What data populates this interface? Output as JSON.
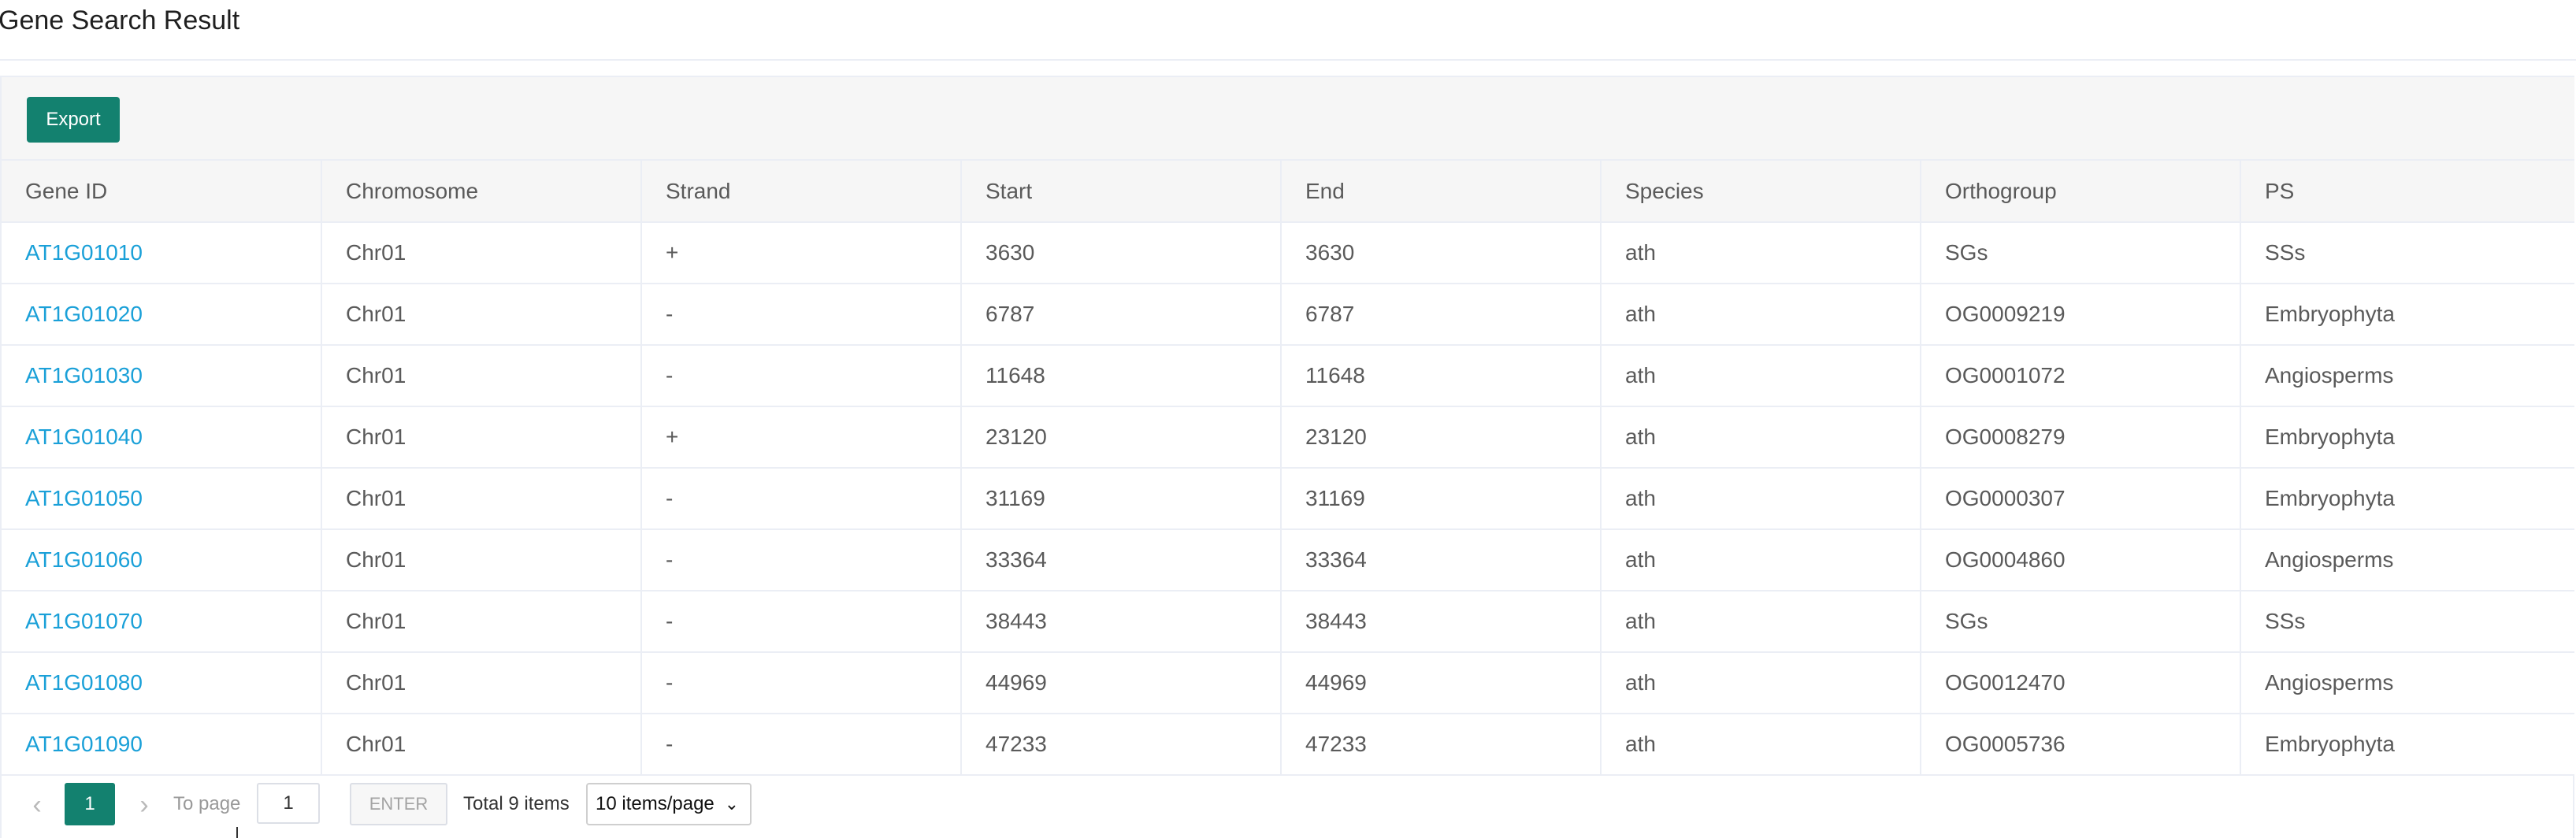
{
  "header": {
    "title": "Gene Search Result"
  },
  "toolbar": {
    "export_label": "Export"
  },
  "table": {
    "columns": [
      "Gene ID",
      "Chromosome",
      "Strand",
      "Start",
      "End",
      "Species",
      "Orthogroup",
      "PS"
    ],
    "rows": [
      [
        "AT1G01010",
        "Chr01",
        "+",
        "3630",
        "3630",
        "ath",
        "SGs",
        "SSs"
      ],
      [
        "AT1G01020",
        "Chr01",
        "-",
        "6787",
        "6787",
        "ath",
        "OG0009219",
        "Embryophyta"
      ],
      [
        "AT1G01030",
        "Chr01",
        "-",
        "11648",
        "11648",
        "ath",
        "OG0001072",
        "Angiosperms"
      ],
      [
        "AT1G01040",
        "Chr01",
        "+",
        "23120",
        "23120",
        "ath",
        "OG0008279",
        "Embryophyta"
      ],
      [
        "AT1G01050",
        "Chr01",
        "-",
        "31169",
        "31169",
        "ath",
        "OG0000307",
        "Embryophyta"
      ],
      [
        "AT1G01060",
        "Chr01",
        "-",
        "33364",
        "33364",
        "ath",
        "OG0004860",
        "Angiosperms"
      ],
      [
        "AT1G01070",
        "Chr01",
        "-",
        "38443",
        "38443",
        "ath",
        "SGs",
        "SSs"
      ],
      [
        "AT1G01080",
        "Chr01",
        "-",
        "44969",
        "44969",
        "ath",
        "OG0012470",
        "Angiosperms"
      ],
      [
        "AT1G01090",
        "Chr01",
        "-",
        "47233",
        "47233",
        "ath",
        "OG0005736",
        "Embryophyta"
      ]
    ]
  },
  "pagination": {
    "prev_icon": "chevron-left-icon",
    "next_icon": "chevron-right-icon",
    "current_page": "1",
    "to_page_label": "To page",
    "page_input_value": "1",
    "enter_label": "ENTER",
    "total_label": "Total 9 items",
    "page_size_selected": "10 items/page"
  },
  "colors": {
    "accent": "#13816f",
    "link": "#1aa0d8",
    "header_bg": "#f6f6f6",
    "border": "#ebeef5"
  }
}
